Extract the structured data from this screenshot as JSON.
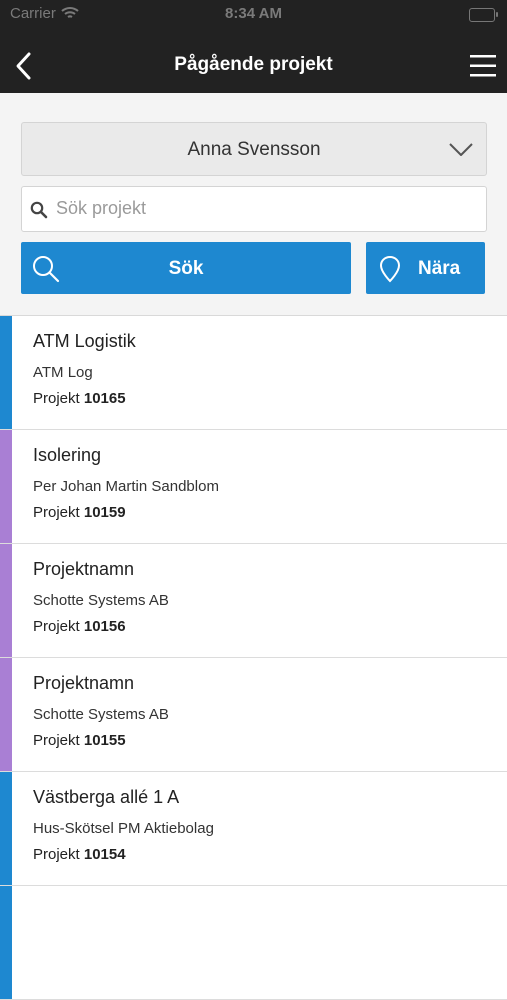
{
  "status_bar": {
    "carrier": "Carrier",
    "time": "8:34 AM"
  },
  "header": {
    "title": "Pågående projekt",
    "back_icon": "chevron-left-icon",
    "menu_icon": "hamburger-menu-icon"
  },
  "user_select": {
    "value": "Anna Svensson"
  },
  "search": {
    "placeholder": "Sök projekt",
    "value": ""
  },
  "buttons": {
    "search_label": "Sök",
    "nearby_label": "Nära"
  },
  "colors": {
    "header_bg": "#222222",
    "accent": "#1e88d0",
    "purple": "#a97fd4"
  },
  "projects": [
    {
      "name": "ATM Logistik",
      "client": "ATM Log",
      "project_prefix": "Projekt",
      "number": "10165",
      "color": "#1e88d0"
    },
    {
      "name": "Isolering",
      "client": "Per Johan Martin Sandblom",
      "project_prefix": "Projekt",
      "number": "10159",
      "color": "#a97fd4"
    },
    {
      "name": "Projektnamn",
      "client": "Schotte Systems AB",
      "project_prefix": "Projekt",
      "number": "10156",
      "color": "#a97fd4"
    },
    {
      "name": "Projektnamn",
      "client": "Schotte Systems AB",
      "project_prefix": "Projekt",
      "number": "10155",
      "color": "#a97fd4"
    },
    {
      "name": "Västberga allé 1 A",
      "client": "Hus-Skötsel PM Aktiebolag",
      "project_prefix": "Projekt",
      "number": "10154",
      "color": "#1e88d0"
    },
    {
      "name": "",
      "client": "",
      "project_prefix": "",
      "number": "",
      "color": "#1e88d0"
    }
  ]
}
